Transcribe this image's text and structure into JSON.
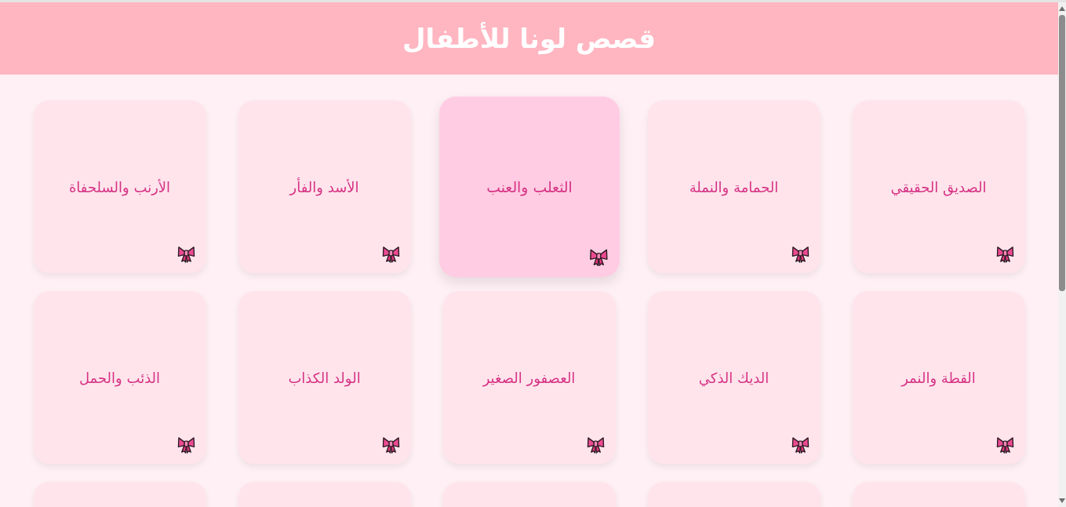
{
  "header": {
    "title": "قصص لونا للأطفال"
  },
  "cards": [
    {
      "title": "الصديق الحقيقي",
      "highlighted": false
    },
    {
      "title": "الحمامة والنملة",
      "highlighted": false
    },
    {
      "title": "الثعلب والعنب",
      "highlighted": true
    },
    {
      "title": "الأسد والفأر",
      "highlighted": false
    },
    {
      "title": "الأرنب والسلحفاة",
      "highlighted": false
    },
    {
      "title": "القطة والنمر",
      "highlighted": false
    },
    {
      "title": "الديك الذكي",
      "highlighted": false
    },
    {
      "title": "العصفور الصغير",
      "highlighted": false
    },
    {
      "title": "الولد الكذاب",
      "highlighted": false
    },
    {
      "title": "الذئب والحمل",
      "highlighted": false
    },
    {
      "highlighted": false
    },
    {
      "highlighted": false
    },
    {
      "highlighted": false
    },
    {
      "highlighted": false
    },
    {
      "highlighted": false
    }
  ]
}
